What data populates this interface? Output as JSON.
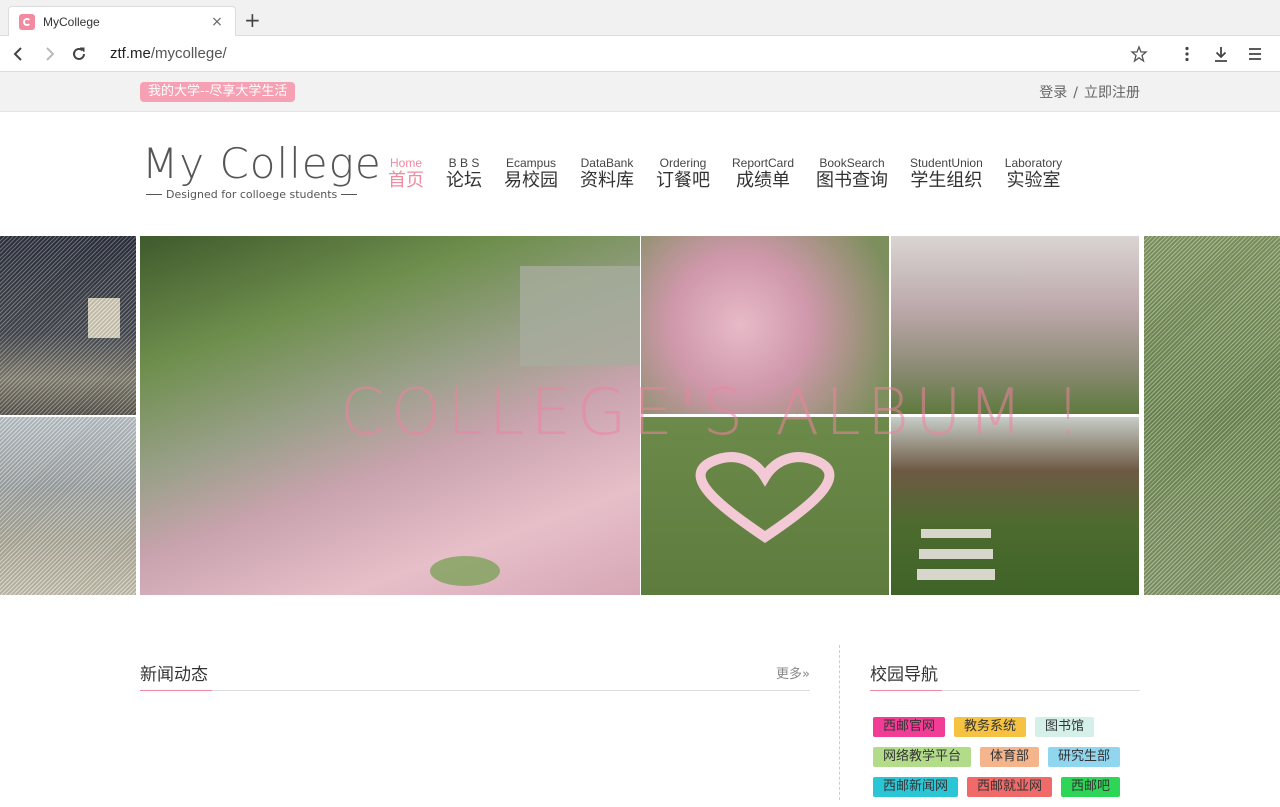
{
  "browser": {
    "tab_title": "MyCollege",
    "close_glyph": "×",
    "new_tab_glyph": "+",
    "url_host": "ztf.me",
    "url_path": "/mycollege/"
  },
  "topbar": {
    "slogan": "我的大学--尽享大学生活",
    "login": "登录",
    "separator": "/",
    "register": "立即注册"
  },
  "logo": {
    "title": "My College",
    "subtitle": "Designed for colloege students"
  },
  "nav": [
    {
      "en": "Home",
      "zh": "首页",
      "active": true
    },
    {
      "en": "B B S",
      "zh": "论坛"
    },
    {
      "en": "Ecampus",
      "zh": "易校园"
    },
    {
      "en": "DataBank",
      "zh": "资料库"
    },
    {
      "en": "Ordering",
      "zh": "订餐吧"
    },
    {
      "en": "ReportCard",
      "zh": "成绩单"
    },
    {
      "en": "BookSearch",
      "zh": "图书查询"
    },
    {
      "en": "StudentUnion",
      "zh": "学生组织"
    },
    {
      "en": "Laboratory",
      "zh": "实验室"
    }
  ],
  "album": {
    "title": "COLLEGE'S ALBUM !"
  },
  "news": {
    "title": "新闻动态",
    "more": "更多»"
  },
  "campus": {
    "title": "校园导航",
    "links": [
      {
        "label": "西邮官网",
        "color": "#f23d97"
      },
      {
        "label": "教务系统",
        "color": "#f5c242"
      },
      {
        "label": "图书馆",
        "color": "#d4f0e8"
      },
      {
        "label": "网络教学平台",
        "color": "#b2dc8a"
      },
      {
        "label": "体育部",
        "color": "#f4b48c"
      },
      {
        "label": "研究生部",
        "color": "#8fd6ee"
      },
      {
        "label": "西邮新闻网",
        "color": "#2bc6d6"
      },
      {
        "label": "西邮就业网",
        "color": "#f06a6a"
      },
      {
        "label": "西邮吧",
        "color": "#2ed657"
      }
    ]
  }
}
